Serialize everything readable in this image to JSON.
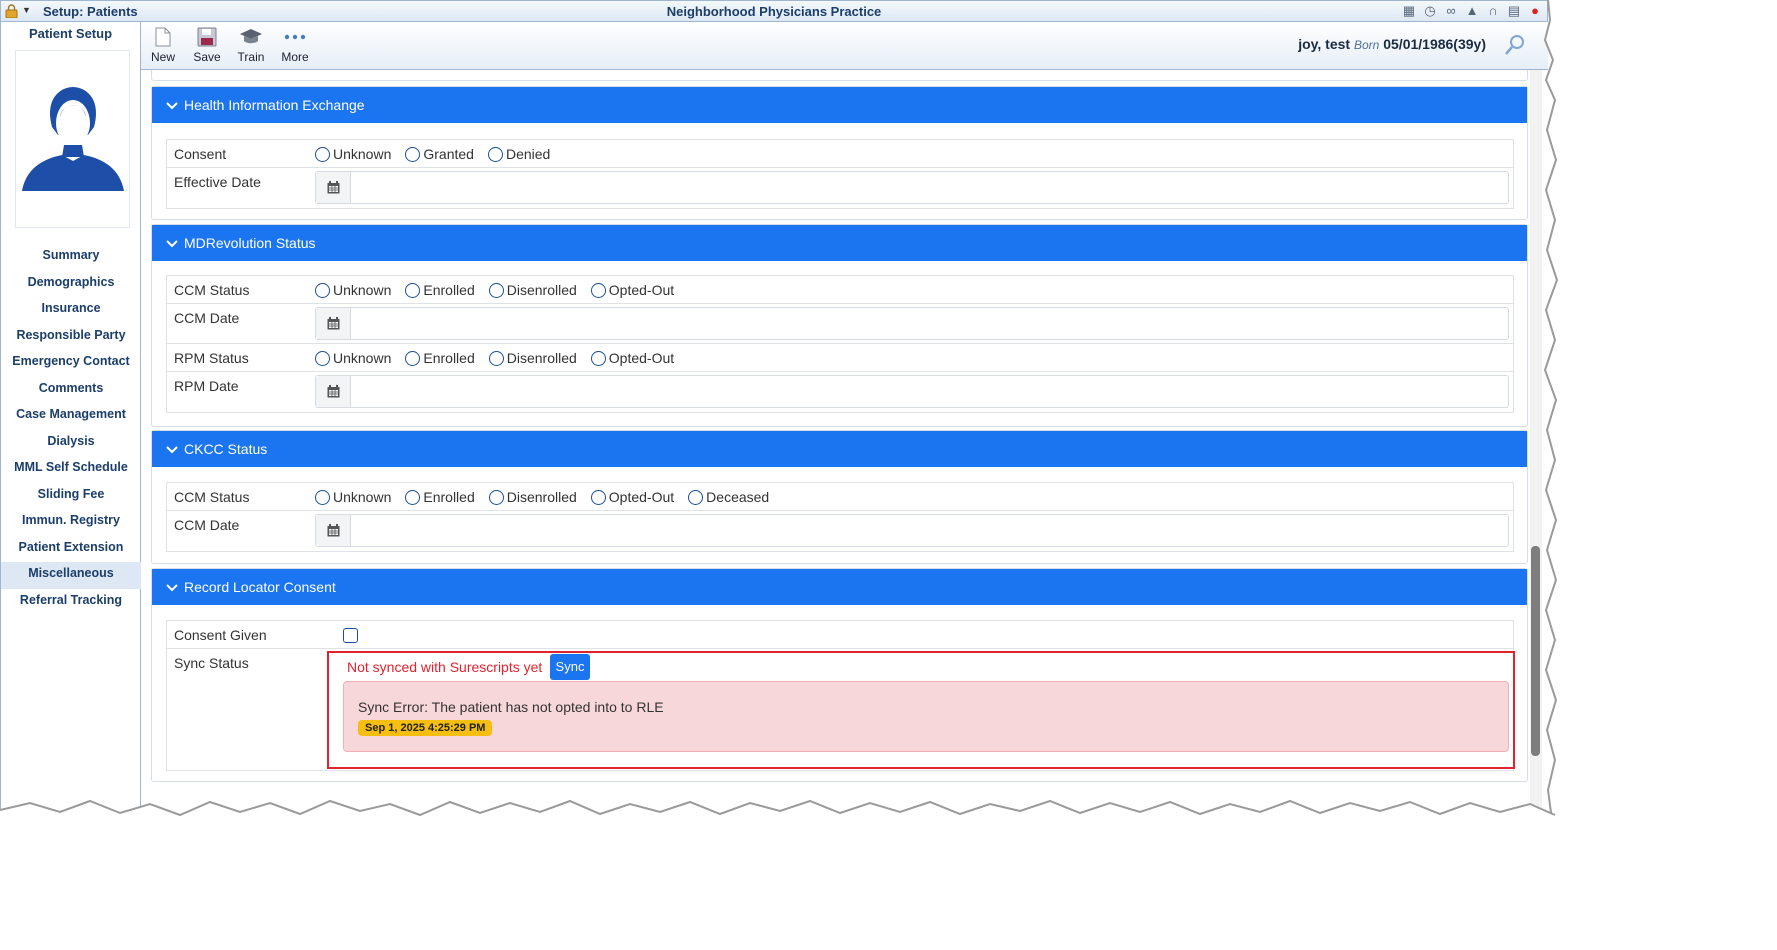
{
  "titlebar": {
    "setup_label": "Setup: Patients",
    "app_title": "Neighborhood Physicians Practice",
    "icons": [
      "map-icon",
      "stopwatch-icon",
      "binoculars-icon",
      "graduation-cap-icon",
      "headset-icon",
      "calculator-icon",
      "close-icon"
    ]
  },
  "sidebar": {
    "title": "Patient Setup",
    "items": [
      {
        "label": "Summary"
      },
      {
        "label": "Demographics"
      },
      {
        "label": "Insurance"
      },
      {
        "label": "Responsible Party"
      },
      {
        "label": "Emergency Contact"
      },
      {
        "label": "Comments"
      },
      {
        "label": "Case Management"
      },
      {
        "label": "Dialysis"
      },
      {
        "label": "MML Self Schedule"
      },
      {
        "label": "Sliding Fee"
      },
      {
        "label": "Immun. Registry"
      },
      {
        "label": "Patient Extension"
      },
      {
        "label": "Miscellaneous",
        "active": true
      },
      {
        "label": "Referral Tracking"
      }
    ]
  },
  "toolbar": {
    "new_label": "New",
    "save_label": "Save",
    "train_label": "Train",
    "more_label": "More"
  },
  "patient": {
    "name": "joy, test",
    "born_label": "Born",
    "dob": "05/01/1986(39y)"
  },
  "hie": {
    "title": "Health Information Exchange",
    "consent_label": "Consent",
    "consent_options": [
      "Unknown",
      "Granted",
      "Denied"
    ],
    "effective_label": "Effective Date"
  },
  "mdr": {
    "title": "MDRevolution Status",
    "ccm_status_label": "CCM Status",
    "ccm_options": [
      "Unknown",
      "Enrolled",
      "Disenrolled",
      "Opted-Out"
    ],
    "ccm_date_label": "CCM Date",
    "rpm_status_label": "RPM Status",
    "rpm_options": [
      "Unknown",
      "Enrolled",
      "Disenrolled",
      "Opted-Out"
    ],
    "rpm_date_label": "RPM Date"
  },
  "ckcc": {
    "title": "CKCC Status",
    "ccm_status_label": "CCM Status",
    "ccm_options": [
      "Unknown",
      "Enrolled",
      "Disenrolled",
      "Opted-Out",
      "Deceased"
    ],
    "ccm_date_label": "CCM Date"
  },
  "rlc": {
    "title": "Record Locator Consent",
    "consent_given_label": "Consent Given",
    "sync_status_label": "Sync Status",
    "sync_message": "Not synced with Surescripts yet",
    "sync_button": "Sync",
    "error_text": "Sync Error: The patient has not opted into to RLE",
    "error_time": "Sep 1, 2025 4:25:29 PM"
  },
  "colors": {
    "panel_header": "#1b74f0",
    "error_red": "#e0232e",
    "error_bg": "#f8d7da",
    "badge_yellow": "#f5be10",
    "nav_text": "#1b3e6a"
  }
}
